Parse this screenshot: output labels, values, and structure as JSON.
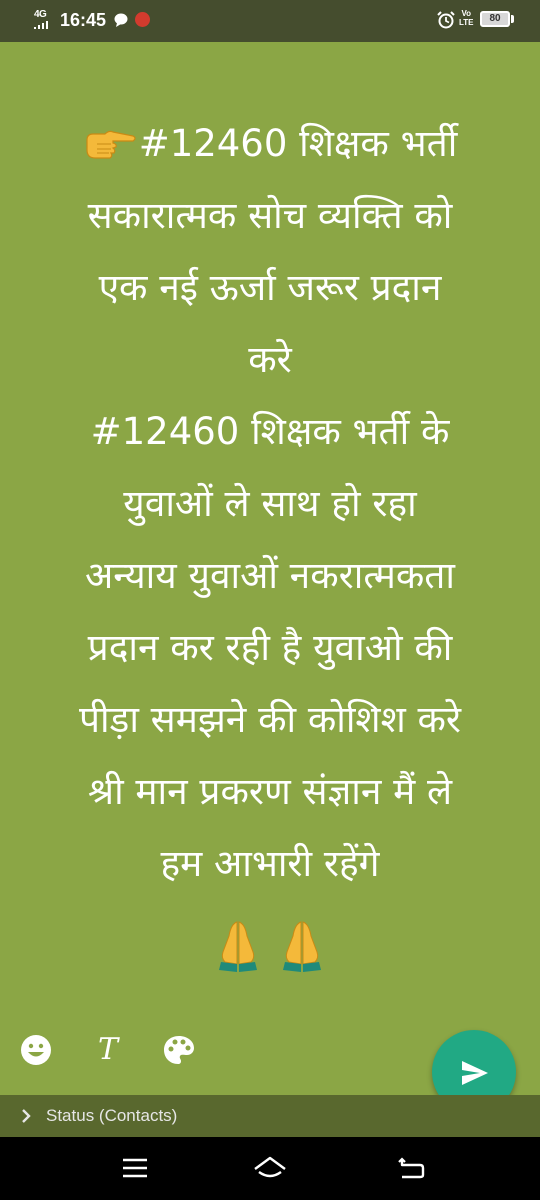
{
  "status_bar": {
    "network": "4G",
    "time": "16:45",
    "volte": "Vo\nLTE",
    "battery": "80"
  },
  "status_post": {
    "text": "#12460 शिक्षक भर्ती\nसकारात्मक सोच व्यक्ति को\nएक नई ऊर्जा जरूर प्रदान\nकरे\n#12460 शिक्षक भर्ती के\nयुवाओं ले साथ हो रहा\nअन्याय युवाओं नकरात्मकता\nप्रदान कर रही है युवाओ की\nपीड़ा समझने की कोशिश करे\nश्री मान प्रकरण संज्ञान मैं ले\nहम आभारी रहेंगे",
    "leading_icon": "backhand-index-pointing-right-icon",
    "trailing_icons": [
      "folded-hands-icon",
      "folded-hands-icon"
    ],
    "background_color": "#8ba645"
  },
  "toolbar": {
    "emoji_icon": "emoji-icon",
    "font_icon": "font-icon",
    "font_glyph": "T",
    "color_icon": "palette-icon",
    "send_icon": "send-icon",
    "send_color": "#21a984"
  },
  "audience": {
    "label": "Status (Contacts)"
  },
  "nav_bar": {
    "items": [
      "menu-icon",
      "home-icon",
      "back-icon"
    ]
  }
}
